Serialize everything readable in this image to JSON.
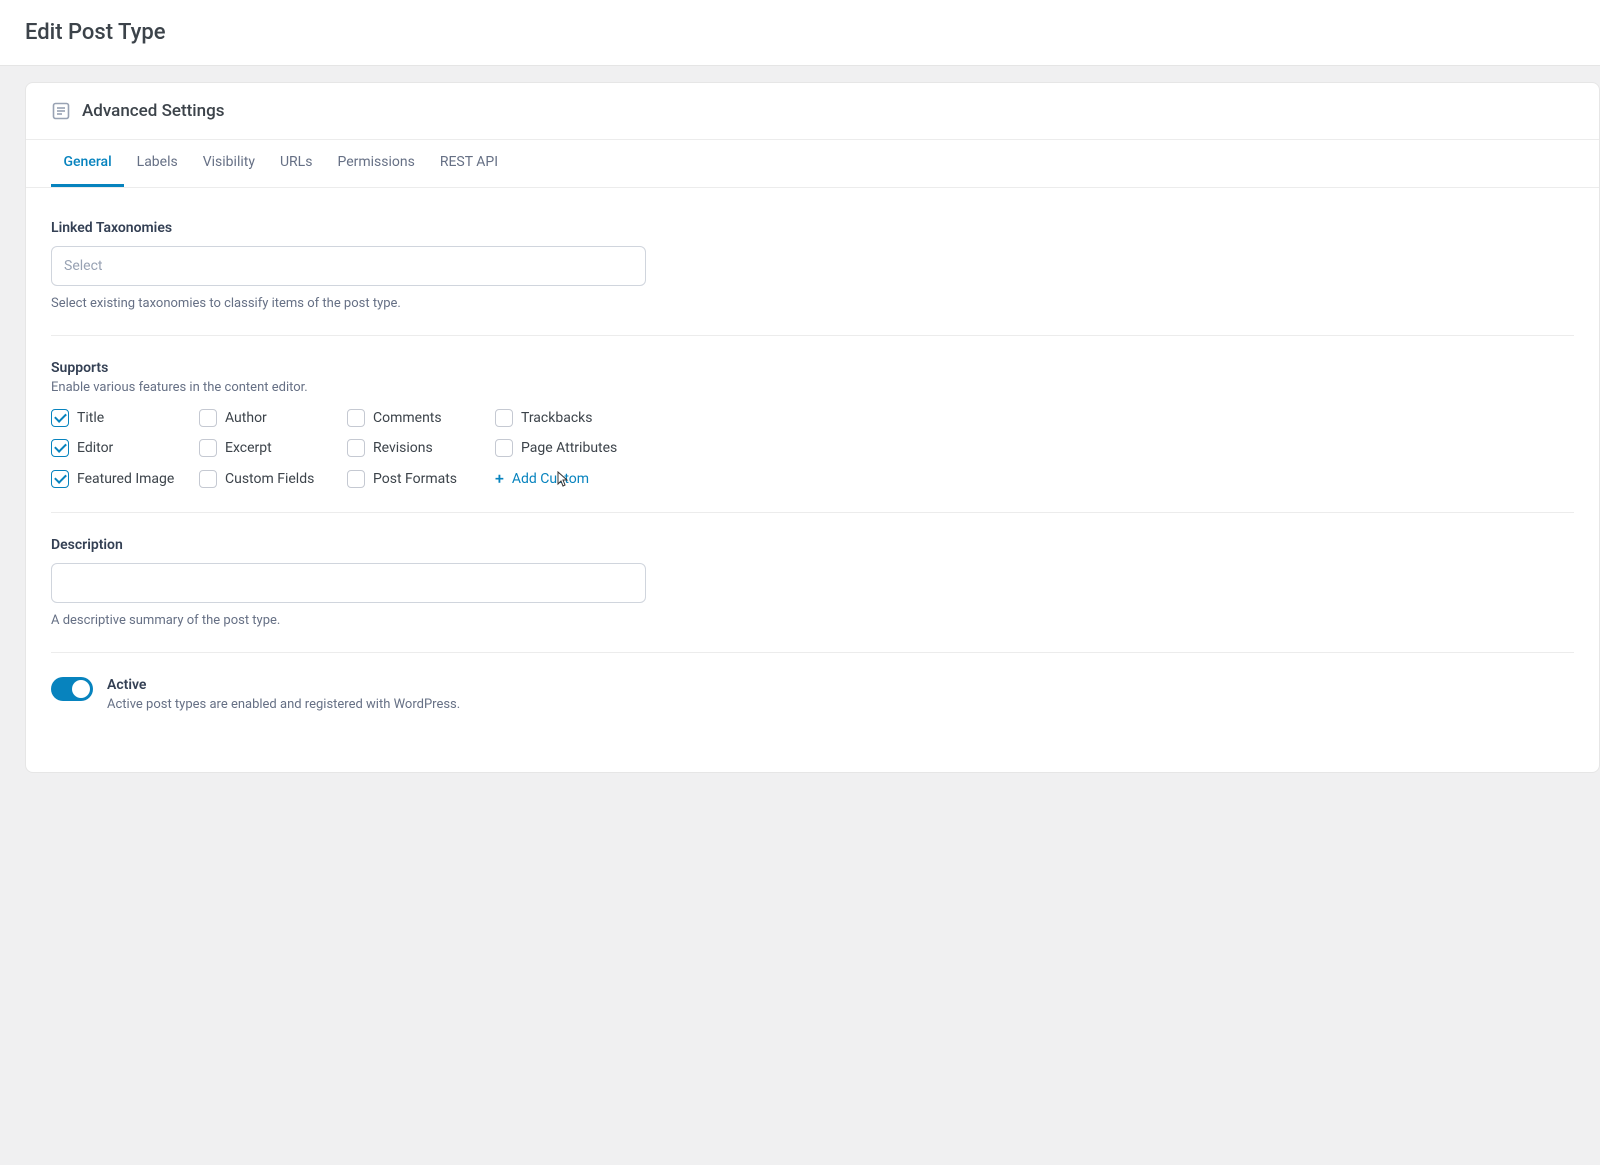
{
  "page": {
    "title": "Edit Post Type"
  },
  "panel": {
    "title": "Advanced Settings"
  },
  "tabs": [
    {
      "label": "General",
      "active": true
    },
    {
      "label": "Labels",
      "active": false
    },
    {
      "label": "Visibility",
      "active": false
    },
    {
      "label": "URLs",
      "active": false
    },
    {
      "label": "Permissions",
      "active": false
    },
    {
      "label": "REST API",
      "active": false
    }
  ],
  "taxonomies": {
    "label": "Linked Taxonomies",
    "placeholder": "Select",
    "help": "Select existing taxonomies to classify items of the post type."
  },
  "supports": {
    "label": "Supports",
    "sublabel": "Enable various features in the content editor.",
    "items": [
      {
        "key": "title",
        "label": "Title",
        "checked": true
      },
      {
        "key": "author",
        "label": "Author",
        "checked": false
      },
      {
        "key": "comments",
        "label": "Comments",
        "checked": false
      },
      {
        "key": "trackbacks",
        "label": "Trackbacks",
        "checked": false
      },
      {
        "key": "editor",
        "label": "Editor",
        "checked": true
      },
      {
        "key": "excerpt",
        "label": "Excerpt",
        "checked": false
      },
      {
        "key": "revisions",
        "label": "Revisions",
        "checked": false
      },
      {
        "key": "page-attributes",
        "label": "Page Attributes",
        "checked": false
      },
      {
        "key": "featured-image",
        "label": "Featured Image",
        "checked": true
      },
      {
        "key": "custom-fields",
        "label": "Custom Fields",
        "checked": false
      },
      {
        "key": "post-formats",
        "label": "Post Formats",
        "checked": false
      }
    ],
    "add_custom": "Add Custom"
  },
  "description": {
    "label": "Description",
    "value": "",
    "help": "A descriptive summary of the post type."
  },
  "active": {
    "label": "Active",
    "on": true,
    "desc": "Active post types are enabled and registered with WordPress."
  }
}
